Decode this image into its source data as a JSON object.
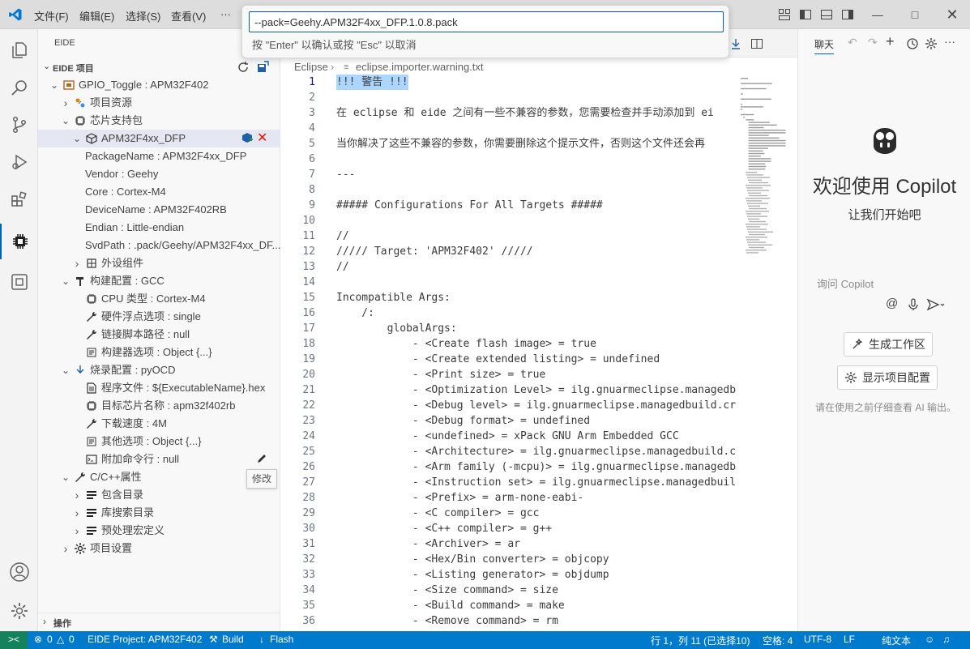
{
  "menu": [
    "文件(F)",
    "编辑(E)",
    "选择(S)",
    "查看(V)",
    "···"
  ],
  "quick_open": {
    "value": "--pack=Geehy.APM32F4xx_DFP.1.0.8.pack",
    "hint": "按 \"Enter\" 以确认或按 \"Esc\" 以取消"
  },
  "sidebar": {
    "view_title": "EIDE",
    "section_title": "EIDE 项目",
    "tree": [
      {
        "text": "GPIO_Toggle : APM32F402",
        "icon": "project-icon",
        "chev": "v"
      },
      {
        "text": "项目资源",
        "icon": "resources-icon",
        "chev": ">"
      },
      {
        "text": "芯片支持包",
        "icon": "chip-icon",
        "chev": "v"
      },
      {
        "text": "APM32F4xx_DFP",
        "icon": "package-icon",
        "chev": "v"
      },
      {
        "text": "PackageName : APM32F4xx_DFP",
        "icon": "",
        "chev": ""
      },
      {
        "text": "Vendor : Geehy",
        "icon": "",
        "chev": ""
      },
      {
        "text": "Core : Cortex-M4",
        "icon": "",
        "chev": ""
      },
      {
        "text": "DeviceName : APM32F402RB",
        "icon": "",
        "chev": ""
      },
      {
        "text": "Endian : Little-endian",
        "icon": "",
        "chev": ""
      },
      {
        "text": "SvdPath : .pack/Geehy/APM32F4xx_DF...",
        "icon": "",
        "chev": ""
      },
      {
        "text": "外设组件",
        "icon": "peripheral-icon",
        "chev": ">"
      },
      {
        "text": "构建配置 : GCC",
        "icon": "hammer-icon",
        "chev": "v"
      },
      {
        "text": "CPU 类型 : Cortex-M4",
        "icon": "chip-icon",
        "chev": ""
      },
      {
        "text": "硬件浮点选项 : single",
        "icon": "wrench-icon",
        "chev": ""
      },
      {
        "text": "链接脚本路径 : null",
        "icon": "wrench-icon",
        "chev": ""
      },
      {
        "text": "构建器选项 : Object {...}",
        "icon": "options-icon",
        "chev": ""
      },
      {
        "text": "烧录配置 : pyOCD",
        "icon": "download-icon",
        "chev": "v"
      },
      {
        "text": "程序文件 : ${ExecutableName}.hex",
        "icon": "file-icon",
        "chev": ""
      },
      {
        "text": "目标芯片名称 : apm32f402rb",
        "icon": "chip-icon",
        "chev": ""
      },
      {
        "text": "下载速度 : 4M",
        "icon": "wrench-icon",
        "chev": ""
      },
      {
        "text": "其他选项 : Object {...}",
        "icon": "options-icon",
        "chev": ""
      },
      {
        "text": "附加命令行 : null",
        "icon": "terminal-icon",
        "chev": ""
      },
      {
        "text": "C/C++属性",
        "icon": "wrench-icon",
        "chev": "v"
      },
      {
        "text": "包含目录",
        "icon": "list-icon",
        "chev": ">"
      },
      {
        "text": "库搜索目录",
        "icon": "list-icon",
        "chev": ">"
      },
      {
        "text": "预处理宏定义",
        "icon": "list-icon",
        "chev": ">"
      },
      {
        "text": "项目设置",
        "icon": "gear-icon",
        "chev": ">"
      }
    ],
    "tooltip": "修改",
    "bottom_section": "操作"
  },
  "editor": {
    "breadcrumb_folder": "Eclipse",
    "breadcrumb_file": "eclipse.importer.warning.txt",
    "lines": [
      "!!! 警告 !!!",
      "",
      "在 eclipse 和 eide 之间有一些不兼容的参数，您需要检查并手动添加到 ei",
      "",
      "当你解决了这些不兼容的参数，你需要删除这个提示文件，否则这个文件还会再",
      "",
      "---",
      "",
      "##### Configurations For All Targets #####",
      "",
      "//",
      "///// Target: 'APM32F402' /////",
      "//",
      "",
      "Incompatible Args:",
      "    /:",
      "        globalArgs:",
      "            - <Create flash image> = true",
      "            - <Create extended listing> = undefined",
      "            - <Print size> = true",
      "            - <Optimization Level> = ilg.gnuarmeclipse.managedb",
      "            - <Debug level> = ilg.gnuarmeclipse.managedbuild.cr",
      "            - <Debug format> = undefined",
      "            - <undefined> = xPack GNU Arm Embedded GCC",
      "            - <Architecture> = ilg.gnuarmeclipse.managedbuild.c",
      "            - <Arm family (-mcpu)> = ilg.gnuarmeclipse.managedb",
      "            - <Instruction set> = ilg.gnuarmeclipse.managedbuil",
      "            - <Prefix> = arm-none-eabi-",
      "            - <C compiler> = gcc",
      "            - <C++ compiler> = g++",
      "            - <Archiver> = ar",
      "            - <Hex/Bin converter> = objcopy",
      "            - <Listing generator> = objdump",
      "            - <Size command> = size",
      "            - <Build command> = make",
      "            - <Remove command> = rm"
    ]
  },
  "copilot": {
    "tab": "聊天",
    "welcome": "欢迎使用 Copilot",
    "subtitle": "让我们开始吧",
    "input_placeholder": "询问 Copilot",
    "at_symbol": "@",
    "btn_workspace": "生成工作区",
    "btn_config": "显示项目配置",
    "disclaimer": "请在使用之前仔细查看 AI 输出。"
  },
  "statusbar": {
    "errors": "0",
    "warnings": "0",
    "project": "EIDE Project: APM32F402",
    "build": "Build",
    "flash": "Flash",
    "position": "行 1，列 11 (已选择10)",
    "spaces": "空格: 4",
    "encoding": "UTF-8",
    "eol": "LF",
    "lang": "纯文本"
  },
  "colors": {
    "accent": "#005fb8",
    "status": "#007acc",
    "error": "#e51400"
  }
}
